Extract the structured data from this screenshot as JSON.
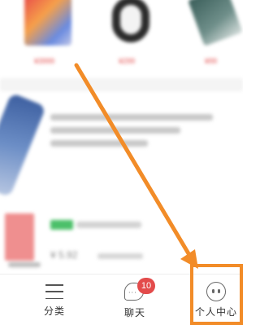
{
  "feed": {
    "prices_small": [
      "¥3999",
      "¥299",
      "¥99"
    ],
    "price_big": "¥ 5.92"
  },
  "tabbar": {
    "tabs": [
      {
        "key": "category",
        "label": "分类",
        "icon": "menu-lines-icon"
      },
      {
        "key": "chat",
        "label": "聊天",
        "icon": "chat-bubble-icon",
        "badge": "10"
      },
      {
        "key": "profile",
        "label": "个人中心",
        "icon": "profile-face-icon"
      }
    ]
  },
  "annotation": {
    "arrow_color": "#f28c28",
    "highlight_color": "#f28c28"
  },
  "colors": {
    "badge": "#e34b4b",
    "accent": "#f28c28"
  }
}
